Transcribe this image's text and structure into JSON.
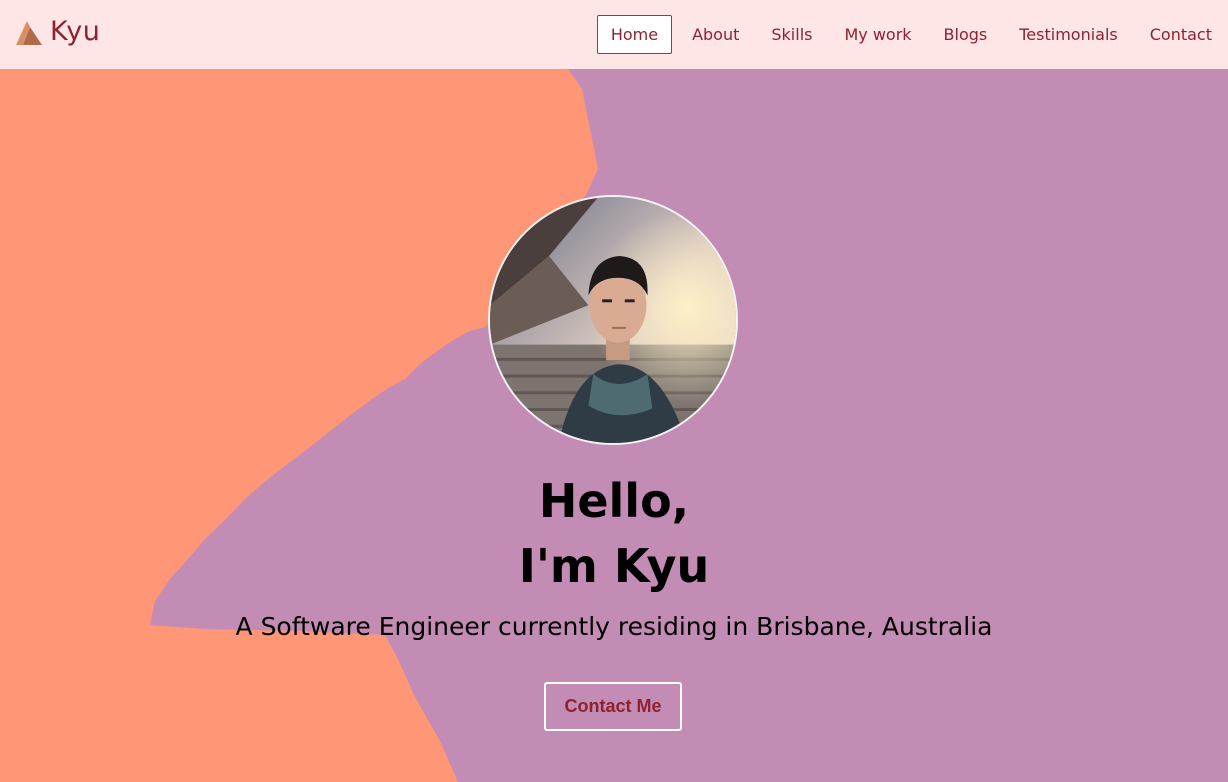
{
  "brand": {
    "name": "Kyu",
    "icon": "mountain-logo-icon",
    "color": "#8e2230"
  },
  "nav": {
    "items": [
      {
        "label": "Home",
        "active": true
      },
      {
        "label": "About"
      },
      {
        "label": "Skills"
      },
      {
        "label": "My work"
      },
      {
        "label": "Blogs"
      },
      {
        "label": "Testimonials"
      },
      {
        "label": "Contact"
      }
    ]
  },
  "hero": {
    "greeting_line1": "Hello,",
    "greeting_line2": "I'm Kyu",
    "tagline": "A Software Engineer currently residing in Brisbane, Australia",
    "cta_label": "Contact Me"
  },
  "colors": {
    "navbar_bg": "#ffe6e6",
    "hero_bg": "#c28cb4",
    "splash": "#ff9675",
    "accent": "#8e2230"
  }
}
